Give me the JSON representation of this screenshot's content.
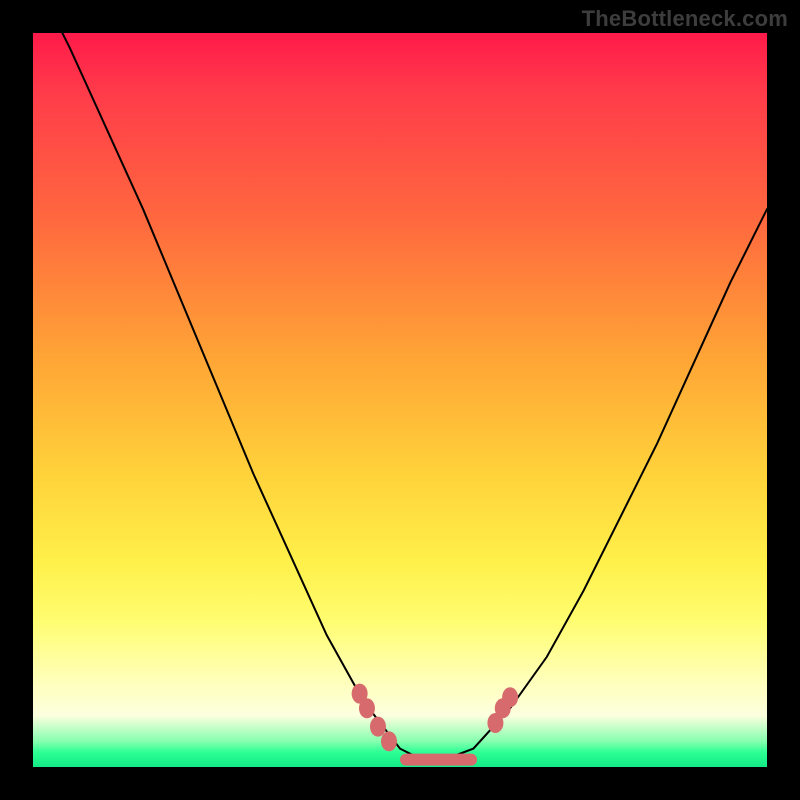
{
  "watermark": "TheBottleneck.com",
  "colors": {
    "frame": "#000000",
    "top": "#ff1a4a",
    "mid": "#ffd23a",
    "bottom": "#13ea85",
    "curve": "#000000",
    "marker": "#d76a6c"
  },
  "chart_data": {
    "type": "line",
    "title": "",
    "xlabel": "",
    "ylabel": "",
    "xlim": [
      0,
      1
    ],
    "ylim": [
      0,
      1
    ],
    "series": [
      {
        "name": "bottleneck-curve",
        "x": [
          0.0,
          0.05,
          0.1,
          0.15,
          0.2,
          0.25,
          0.3,
          0.35,
          0.4,
          0.45,
          0.5,
          0.53,
          0.56,
          0.6,
          0.65,
          0.7,
          0.75,
          0.8,
          0.85,
          0.9,
          0.95,
          1.0
        ],
        "y": [
          1.08,
          0.98,
          0.87,
          0.76,
          0.64,
          0.52,
          0.4,
          0.29,
          0.18,
          0.09,
          0.025,
          0.01,
          0.01,
          0.025,
          0.08,
          0.15,
          0.24,
          0.34,
          0.44,
          0.55,
          0.66,
          0.76
        ]
      }
    ],
    "markers": [
      {
        "x": 0.445,
        "y": 0.1
      },
      {
        "x": 0.455,
        "y": 0.08
      },
      {
        "x": 0.47,
        "y": 0.055
      },
      {
        "x": 0.485,
        "y": 0.035
      },
      {
        "x": 0.63,
        "y": 0.06
      },
      {
        "x": 0.64,
        "y": 0.08
      },
      {
        "x": 0.65,
        "y": 0.095
      }
    ],
    "flat_segment": {
      "x0": 0.5,
      "x1": 0.605,
      "y": 0.01
    }
  }
}
